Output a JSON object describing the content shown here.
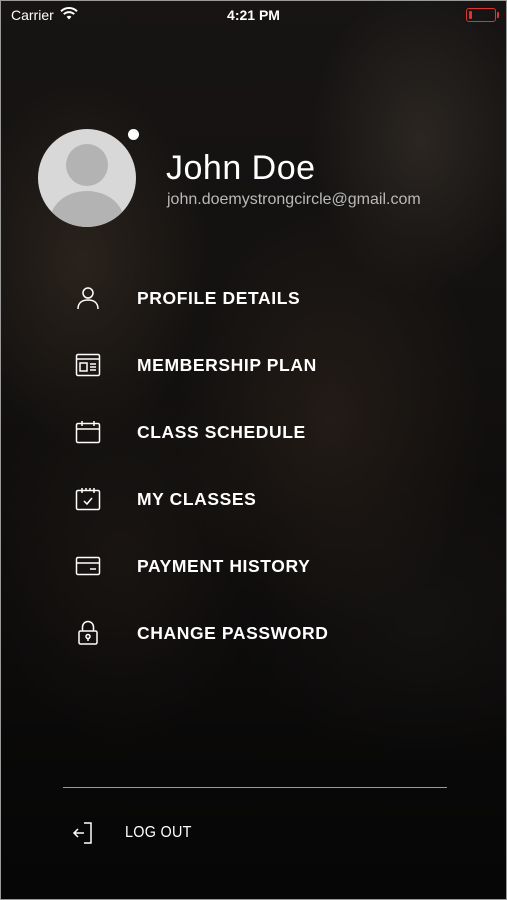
{
  "status_bar": {
    "carrier": "Carrier",
    "time": "4:21 PM",
    "battery_level": 0.1,
    "battery_color": "#dd3333"
  },
  "profile": {
    "name": "John Doe",
    "email": "john.doemystrongcircle@gmail.com",
    "avatar_icon": "person-placeholder-icon",
    "online": true
  },
  "menu": {
    "items": [
      {
        "label": "PROFILE DETAILS",
        "icon": "user-icon"
      },
      {
        "label": "MEMBERSHIP PLAN",
        "icon": "membership-card-icon"
      },
      {
        "label": "CLASS SCHEDULE",
        "icon": "calendar-icon"
      },
      {
        "label": "MY CLASSES",
        "icon": "calendar-check-icon"
      },
      {
        "label": "PAYMENT HISTORY",
        "icon": "credit-card-icon"
      },
      {
        "label": "CHANGE PASSWORD",
        "icon": "lock-icon"
      }
    ],
    "logout_label": "LOG OUT",
    "logout_icon": "logout-icon"
  }
}
